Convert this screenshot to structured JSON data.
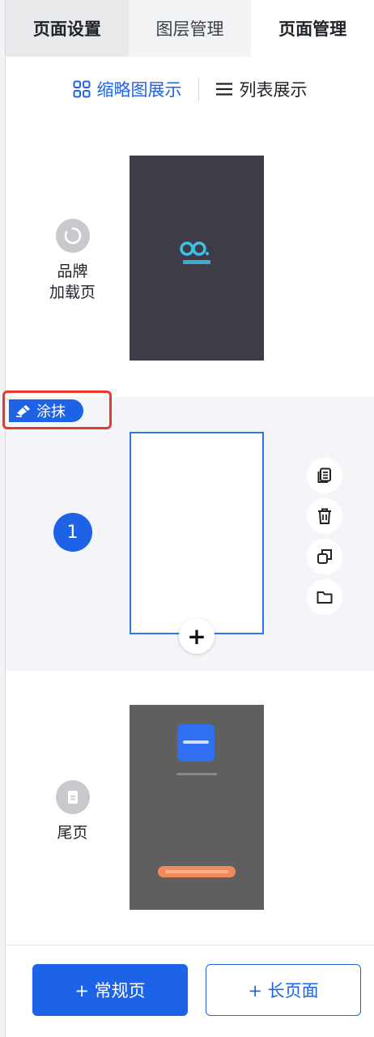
{
  "tabs": [
    {
      "label": "页面设置"
    },
    {
      "label": "图层管理"
    },
    {
      "label": "页面管理"
    }
  ],
  "view_toggle": {
    "thumbnail_label": "缩略图展示",
    "list_label": "列表展示",
    "active": "thumbnail"
  },
  "pages": [
    {
      "label_line1": "品牌",
      "label_line2": "加载页",
      "icon": "loading-icon"
    },
    {
      "index": "1",
      "tag": "涂抹",
      "selected": true
    },
    {
      "label": "尾页",
      "icon": "document-icon"
    }
  ],
  "page_actions": [
    "copy-icon",
    "delete-icon",
    "duplicate-icon",
    "folder-icon"
  ],
  "add_symbol": "+",
  "buttons": {
    "regular_page": "+ 常规页",
    "long_page": "+ 长页面"
  },
  "colors": {
    "accent": "#1d63e8",
    "highlight_box": "#e53a2a",
    "brand_thumb": "#3e3c46",
    "tail_thumb": "#5f5f5f"
  }
}
